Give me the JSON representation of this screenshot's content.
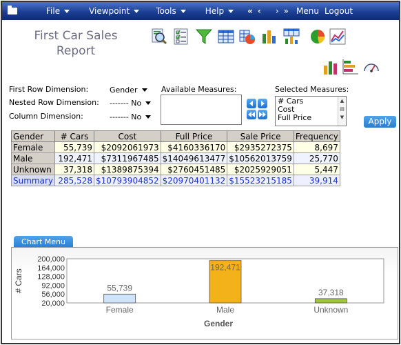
{
  "menubar": {
    "items": [
      {
        "label": "File"
      },
      {
        "label": "Viewpoint"
      },
      {
        "label": "Tools"
      },
      {
        "label": "Help"
      }
    ],
    "nav_first": "«",
    "nav_prev": "‹",
    "nav_next": "›",
    "nav_last": "»",
    "menu_label": "Menu",
    "logout_label": "Logout"
  },
  "title": {
    "line1": "First Car Sales",
    "line2": "Report"
  },
  "toolbar_icons": [
    "search-report-icon",
    "checklist-icon",
    "filter-icon",
    "table-icon",
    "table-pie-icon",
    "table-bar-icon",
    "bar-table-icon",
    "pie-chart-icon",
    "line-chart-icon",
    "bar-chart-icon",
    "stacked-bar-icon",
    "gauge-icon"
  ],
  "dimensions": {
    "first_row_label": "First Row Dimension:",
    "first_row_value": "Gender",
    "nested_row_label": "Nested Row Dimension:",
    "nested_row_value": "------- No",
    "column_label": "Column Dimension:",
    "column_value": "------- No"
  },
  "measures": {
    "available_label": "Available Measures:",
    "selected_label": "Selected Measures:",
    "selected": [
      "# Cars",
      "Cost",
      "Full Price"
    ],
    "apply_label": "Apply"
  },
  "table": {
    "headers": [
      "Gender",
      "# Cars",
      "Cost",
      "Full Price",
      "Sale Price",
      "Frequency"
    ],
    "rows": [
      [
        "Female",
        "55,739",
        "$2092061973",
        "$4160336170",
        "$2935272375",
        "8,697"
      ],
      [
        "Male",
        "192,471",
        "$7311967485",
        "$14049613477",
        "$10562013759",
        "25,770"
      ],
      [
        "Unknown",
        "37,318",
        "$1389875394",
        "$2760451485",
        "$2025929051",
        "5,447"
      ],
      [
        "Summary",
        "285,528",
        "$10793904852",
        "$20970401132",
        "$15523215185",
        "39,914"
      ]
    ]
  },
  "chart_menu_label": "Chart Menu",
  "chart_data": {
    "type": "bar",
    "categories": [
      "Female",
      "Male",
      "Unknown"
    ],
    "values": [
      55739,
      192471,
      37318
    ],
    "value_labels": [
      "55,739",
      "192,471",
      "37,318"
    ],
    "colors": [
      "#cfe4f8",
      "#f3b21a",
      "#9fc53a"
    ],
    "xlabel": "Gender",
    "ylabel": "# Cars",
    "yticks": [
      "200,000",
      "164,000",
      "128,000",
      "92,000",
      "56,000",
      "20,000"
    ],
    "ylim": [
      20000,
      200000
    ]
  }
}
